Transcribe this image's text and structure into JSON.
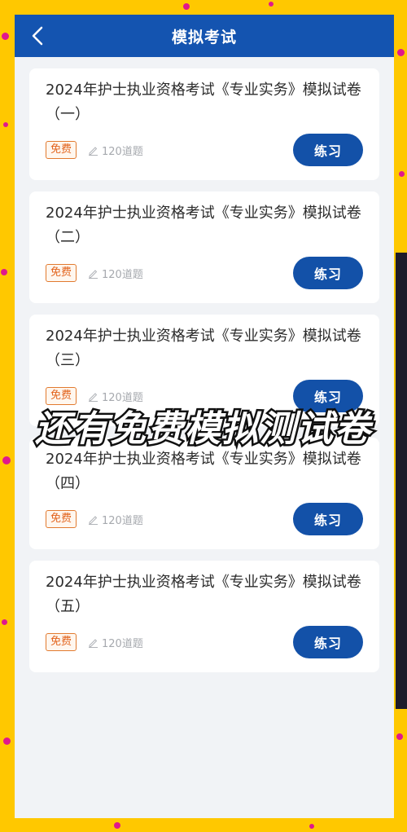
{
  "header": {
    "title": "模拟考试",
    "back_icon": "chevron-left-icon"
  },
  "exams": [
    {
      "title": "2024年护士执业资格考试《专业实务》模拟试卷（一）",
      "badge": "免费",
      "question_count": "120道题",
      "action": "练习"
    },
    {
      "title": "2024年护士执业资格考试《专业实务》模拟试卷（二）",
      "badge": "免费",
      "question_count": "120道题",
      "action": "练习"
    },
    {
      "title": "2024年护士执业资格考试《专业实务》模拟试卷（三）",
      "badge": "免费",
      "question_count": "120道题",
      "action": "练习"
    },
    {
      "title": "2024年护士执业资格考试《专业实务》模拟试卷（四）",
      "badge": "免费",
      "question_count": "120道题",
      "action": "练习"
    },
    {
      "title": "2024年护士执业资格考试《专业实务》模拟试卷（五）",
      "badge": "免费",
      "question_count": "120道题",
      "action": "练习"
    }
  ],
  "overlay_caption": "还有免费模拟测试卷",
  "colors": {
    "header_bg": "#1454b0",
    "button_bg": "#1351a8",
    "badge": "#e2631c",
    "frame_bg": "#ffc800",
    "confetti": "#e0188c"
  }
}
